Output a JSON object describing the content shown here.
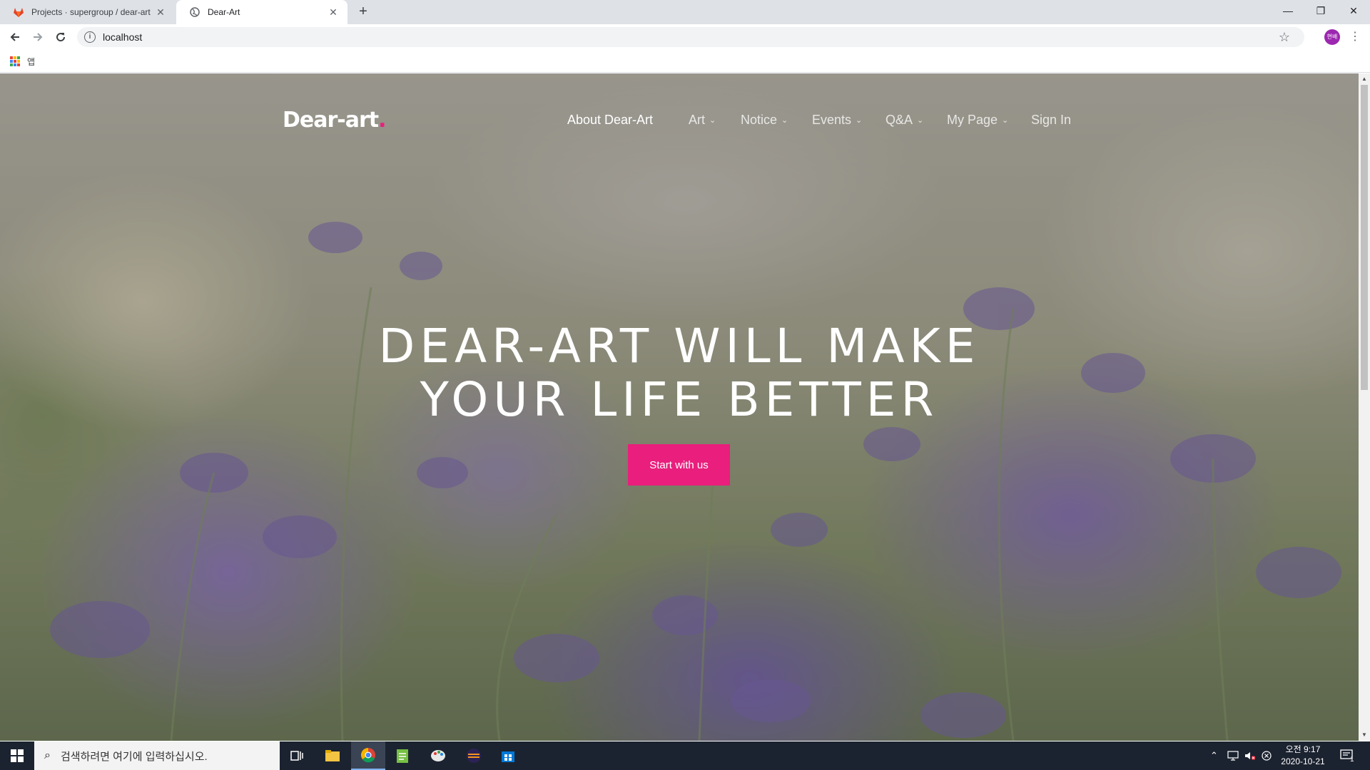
{
  "browser": {
    "tabs": [
      {
        "title": "Projects · supergroup / dear-art",
        "icon": "gitlab-icon",
        "active": false
      },
      {
        "title": "Dear-Art",
        "icon": "globe-icon",
        "active": true
      }
    ],
    "address": "localhost",
    "bookmarks_apps_label": "앱",
    "profile_initials": "현배"
  },
  "site": {
    "logo": "Dear-art",
    "logo_dot": ".",
    "nav": [
      {
        "label": "About Dear-Art",
        "dropdown": false,
        "active": true
      },
      {
        "label": "Art",
        "dropdown": true
      },
      {
        "label": "Notice",
        "dropdown": true
      },
      {
        "label": "Events",
        "dropdown": true
      },
      {
        "label": "Q&A",
        "dropdown": true
      },
      {
        "label": "My Page",
        "dropdown": true
      },
      {
        "label": "Sign In",
        "dropdown": false
      }
    ],
    "hero": {
      "line1": "DEAR-ART WILL MAKE",
      "line2": "YOUR LIFE BETTER",
      "cta": "Start with us"
    },
    "colors": {
      "accent": "#e91e7d"
    }
  },
  "taskbar": {
    "search_placeholder": "검색하려면 여기에 입력하십시오.",
    "time": "오전 9:17",
    "date": "2020-10-21",
    "notification_count": "1"
  }
}
